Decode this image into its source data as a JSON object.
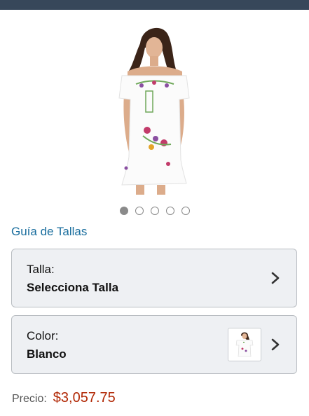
{
  "icons": {
    "product_image": "dress-product-image",
    "chevron": "chevron-right-icon",
    "swatch": "color-swatch-thumbnail"
  },
  "carousel": {
    "count": 5,
    "active_index": 0
  },
  "size_guide": {
    "label": "Guía de Tallas"
  },
  "size_selector": {
    "label": "Talla:",
    "value": "Selecciona Talla"
  },
  "color_selector": {
    "label": "Color:",
    "value": "Blanco"
  },
  "price": {
    "label": "Precio:",
    "value": "$3,057.75"
  },
  "colors": {
    "topbar": "#37475a",
    "link": "#1a6e9e",
    "price": "#b12704",
    "selector_bg": "#eef0f3"
  }
}
